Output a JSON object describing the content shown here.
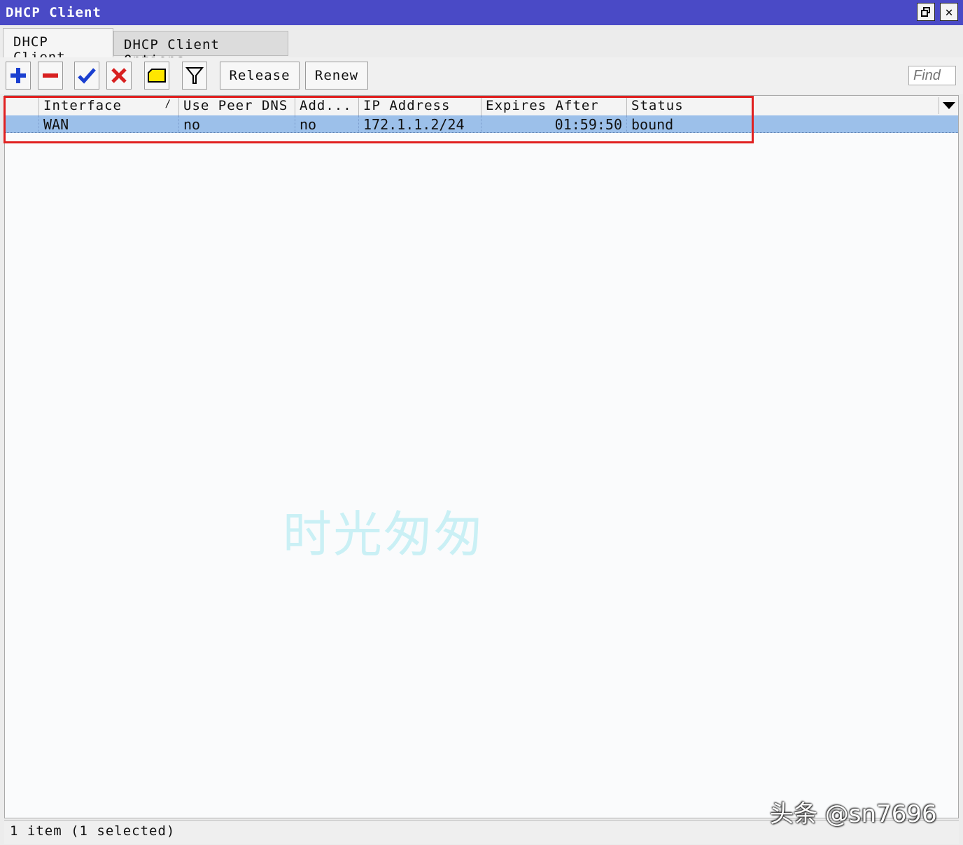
{
  "window": {
    "title": "DHCP Client"
  },
  "tabs": [
    {
      "label": "DHCP Client",
      "active": true
    },
    {
      "label": "DHCP Client Options",
      "active": false
    }
  ],
  "toolbar": {
    "icons": [
      "add-icon",
      "remove-icon",
      "enable-check-icon",
      "disable-x-icon",
      "comment-icon",
      "filter-icon"
    ],
    "release_label": "Release",
    "renew_label": "Renew",
    "find_placeholder": "Find"
  },
  "table": {
    "columns": [
      "Interface",
      "Use Peer DNS",
      "Add...",
      "IP Address",
      "Expires After",
      "Status"
    ],
    "sort_indicator": "/",
    "rows": [
      {
        "interface": "WAN",
        "use_peer_dns": "no",
        "add_default_route": "no",
        "ip_address": "172.1.1.2/24",
        "expires_after": "01:59:50",
        "status": "bound",
        "selected": true
      }
    ]
  },
  "status_bar": {
    "text": "1 item (1 selected)"
  },
  "watermark": "时光匆匆",
  "brand_overlay": "头条 @sn7696",
  "colors": {
    "titlebar": "#4a4ac6",
    "selected_row": "#9cc0ea",
    "highlight_box": "#e02020"
  }
}
